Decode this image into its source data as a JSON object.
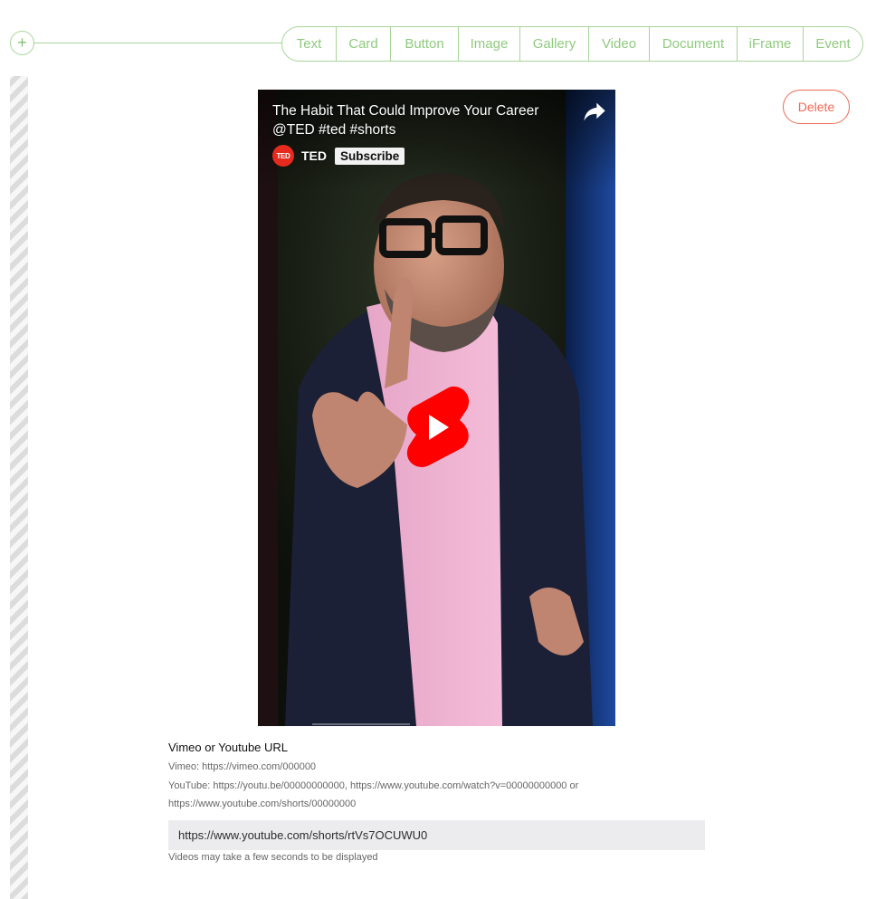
{
  "toolbar": {
    "add_symbol": "+",
    "tabs": [
      "Text",
      "Card",
      "Button",
      "Image",
      "Gallery",
      "Video",
      "Document",
      "iFrame",
      "Event"
    ]
  },
  "block": {
    "delete_label": "Delete"
  },
  "video": {
    "title": "The Habit That Could Improve Your Career @TED #ted #shorts",
    "channel_logo": "TED",
    "channel_name": "TED",
    "subscribe_label": "Subscribe"
  },
  "form": {
    "label": "Vimeo or Youtube URL",
    "help_vimeo": "Vimeo: https://vimeo.com/000000",
    "help_youtube": "YouTube: https://youtu.be/00000000000, https://www.youtube.com/watch?v=00000000000 or https://www.youtube.com/shorts/00000000",
    "url_value": "https://www.youtube.com/shorts/rtVs7OCUWU0",
    "footnote": "Videos may take a few seconds to be displayed"
  },
  "colors": {
    "accent_green": "#8fca7e",
    "delete_red": "#ee6a55",
    "youtube_red": "#ff0000",
    "ted_red": "#e62b1e"
  },
  "icons": {
    "add": "plus-icon",
    "share": "share-arrow-icon",
    "play": "youtube-shorts-play-icon"
  }
}
